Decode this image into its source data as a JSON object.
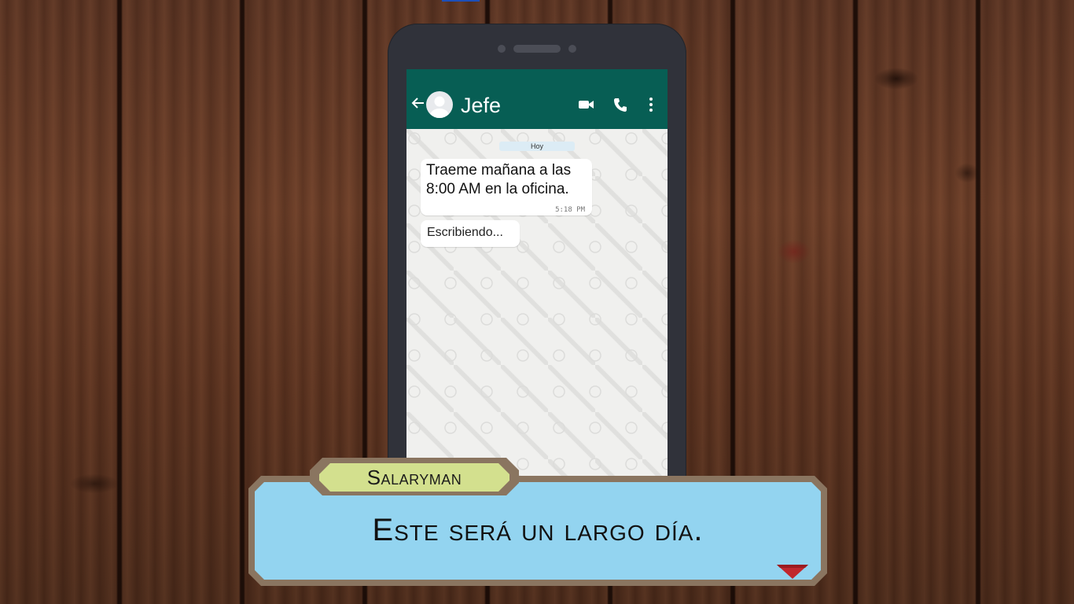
{
  "chat": {
    "contact_name": "Jefe",
    "date_label": "Hoy",
    "messages": [
      {
        "text": "Traeme mañana a las 8:00 AM en la oficina.",
        "time": "5:18 PM"
      }
    ],
    "typing_indicator": "Escribiendo..."
  },
  "icons": {
    "back": "arrow-left-icon",
    "avatar": "user-avatar-icon",
    "video": "video-camera-icon",
    "call": "phone-icon",
    "menu": "more-vert-icon",
    "advance": "triangle-down-icon"
  },
  "dialogue": {
    "speaker": "Salaryman",
    "text": "Este será un largo día."
  },
  "colors": {
    "appbar": "#075e54",
    "dialogue_bg": "#93d4f0",
    "nameplate_bg": "#d3e08e",
    "frame": "#8a7560",
    "advance_arrow": "#c0272d"
  }
}
